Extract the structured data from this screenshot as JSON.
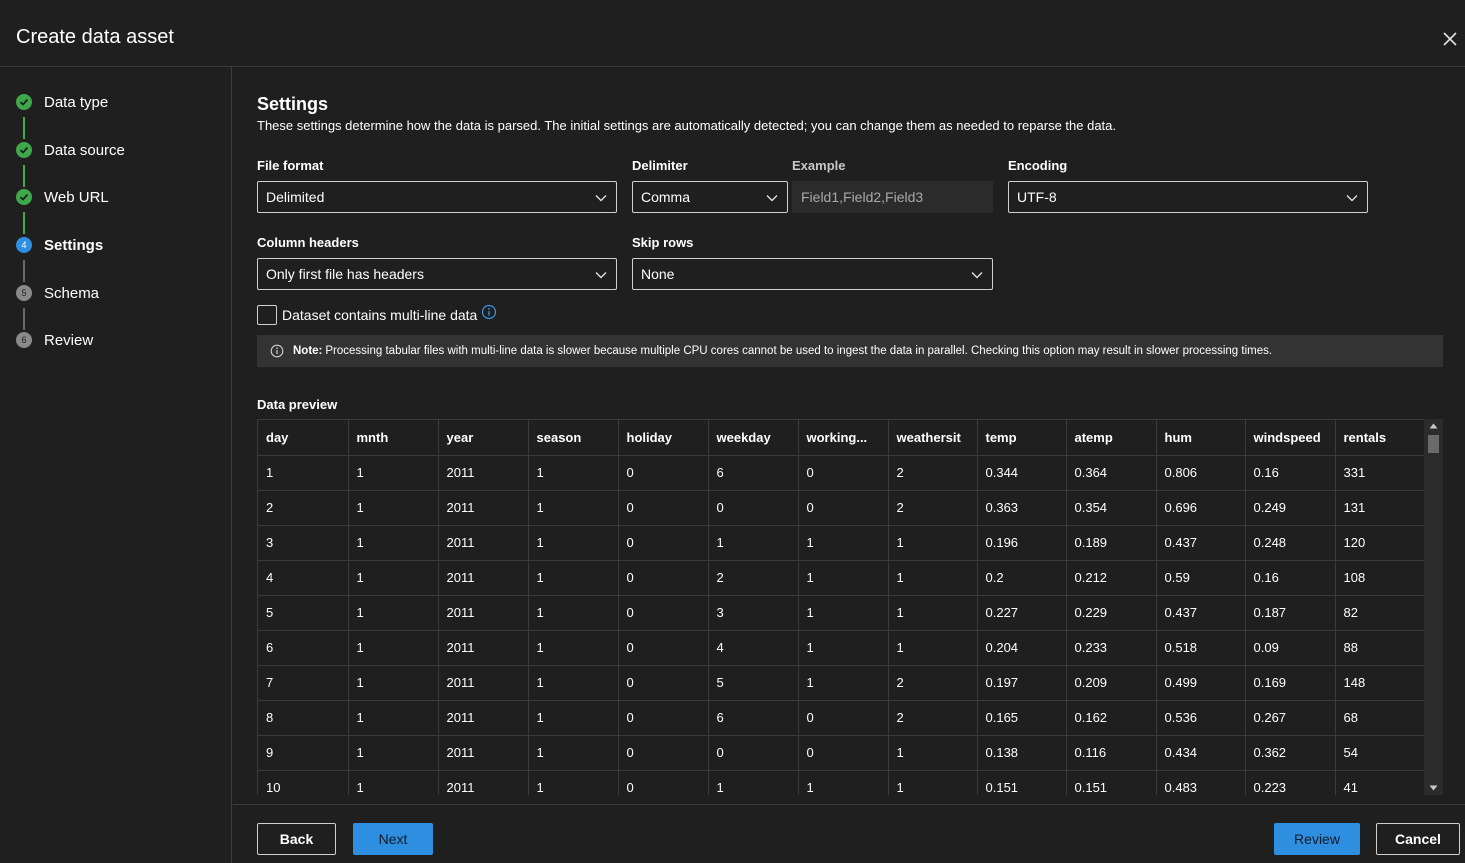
{
  "header": {
    "title": "Create data asset"
  },
  "steps": [
    {
      "label": "Data type",
      "state": "done",
      "number": "1"
    },
    {
      "label": "Data source",
      "state": "done",
      "number": "2"
    },
    {
      "label": "Web URL",
      "state": "done",
      "number": "3"
    },
    {
      "label": "Settings",
      "state": "current",
      "number": "4"
    },
    {
      "label": "Schema",
      "state": "todo",
      "number": "5"
    },
    {
      "label": "Review",
      "state": "todo",
      "number": "6"
    }
  ],
  "settings": {
    "title": "Settings",
    "description": "These settings determine how the data is parsed. The initial settings are automatically detected; you can change them as needed to reparse the data.",
    "file_format": {
      "label": "File format",
      "value": "Delimited"
    },
    "delimiter": {
      "label": "Delimiter",
      "value": "Comma"
    },
    "example": {
      "label": "Example",
      "value": "Field1,Field2,Field3"
    },
    "encoding": {
      "label": "Encoding",
      "value": "UTF-8"
    },
    "column_headers": {
      "label": "Column headers",
      "value": "Only first file has headers"
    },
    "skip_rows": {
      "label": "Skip rows",
      "value": "None"
    },
    "multiline": {
      "label": "Dataset contains multi-line data",
      "checked": false
    },
    "note": {
      "strong": "Note:",
      "text": "Processing tabular files with multi-line data is slower because multiple CPU cores cannot be used to ingest the data in parallel. Checking this option may result in slower processing times."
    }
  },
  "preview": {
    "label": "Data preview",
    "columns": [
      "day",
      "mnth",
      "year",
      "season",
      "holiday",
      "weekday",
      "working...",
      "weathersit",
      "temp",
      "atemp",
      "hum",
      "windspeed",
      "rentals"
    ],
    "rows": [
      [
        "1",
        "1",
        "2011",
        "1",
        "0",
        "6",
        "0",
        "2",
        "0.344",
        "0.364",
        "0.806",
        "0.16",
        "331"
      ],
      [
        "2",
        "1",
        "2011",
        "1",
        "0",
        "0",
        "0",
        "2",
        "0.363",
        "0.354",
        "0.696",
        "0.249",
        "131"
      ],
      [
        "3",
        "1",
        "2011",
        "1",
        "0",
        "1",
        "1",
        "1",
        "0.196",
        "0.189",
        "0.437",
        "0.248",
        "120"
      ],
      [
        "4",
        "1",
        "2011",
        "1",
        "0",
        "2",
        "1",
        "1",
        "0.2",
        "0.212",
        "0.59",
        "0.16",
        "108"
      ],
      [
        "5",
        "1",
        "2011",
        "1",
        "0",
        "3",
        "1",
        "1",
        "0.227",
        "0.229",
        "0.437",
        "0.187",
        "82"
      ],
      [
        "6",
        "1",
        "2011",
        "1",
        "0",
        "4",
        "1",
        "1",
        "0.204",
        "0.233",
        "0.518",
        "0.09",
        "88"
      ],
      [
        "7",
        "1",
        "2011",
        "1",
        "0",
        "5",
        "1",
        "2",
        "0.197",
        "0.209",
        "0.499",
        "0.169",
        "148"
      ],
      [
        "8",
        "1",
        "2011",
        "1",
        "0",
        "6",
        "0",
        "2",
        "0.165",
        "0.162",
        "0.536",
        "0.267",
        "68"
      ],
      [
        "9",
        "1",
        "2011",
        "1",
        "0",
        "0",
        "0",
        "1",
        "0.138",
        "0.116",
        "0.434",
        "0.362",
        "54"
      ],
      [
        "10",
        "1",
        "2011",
        "1",
        "0",
        "1",
        "1",
        "1",
        "0.151",
        "0.151",
        "0.483",
        "0.223",
        "41"
      ]
    ]
  },
  "footer": {
    "back": "Back",
    "next": "Next",
    "review": "Review",
    "cancel": "Cancel"
  },
  "colors": {
    "accent": "#2e8fe0",
    "success": "#3ea94a",
    "background": "#1f1f1f"
  }
}
